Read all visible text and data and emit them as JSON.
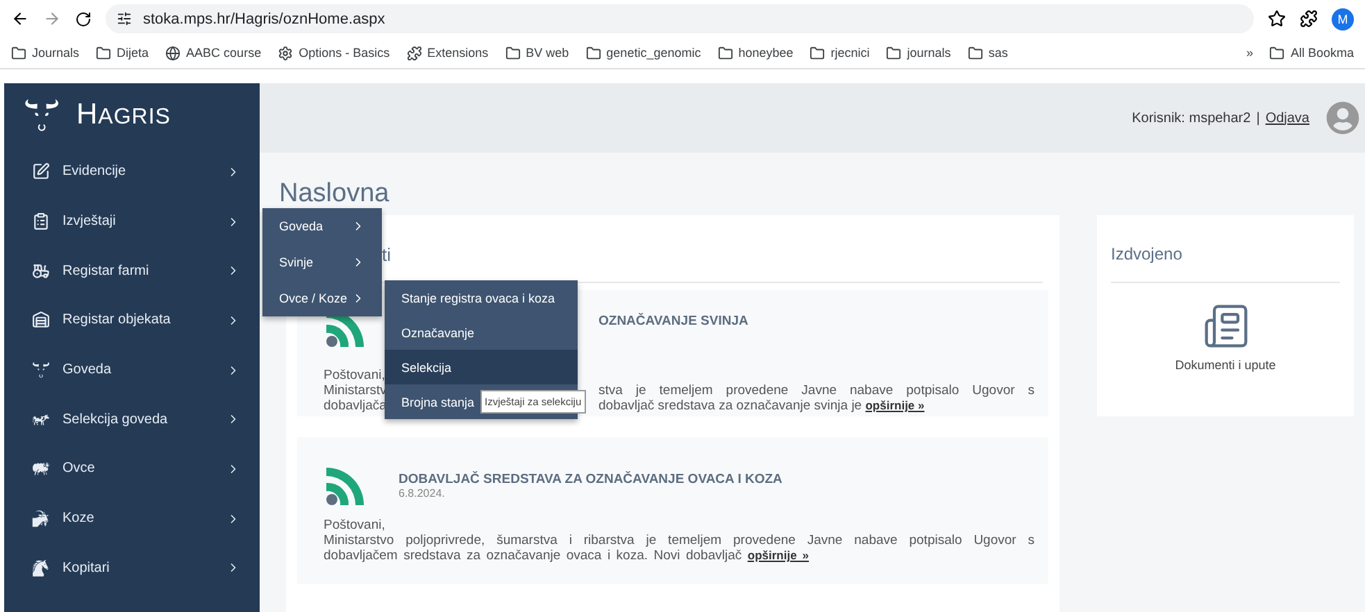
{
  "browser": {
    "url": "stoka.mps.hr/Hagris/oznHome.aspx",
    "profile_initial": "M",
    "bookmarks": [
      {
        "label": "Journals",
        "kind": "folder"
      },
      {
        "label": "Dijeta",
        "kind": "folder"
      },
      {
        "label": "AABC course",
        "kind": "globe"
      },
      {
        "label": "Options - Basics",
        "kind": "gear"
      },
      {
        "label": "Extensions",
        "kind": "puzzle"
      },
      {
        "label": "BV web",
        "kind": "folder"
      },
      {
        "label": "genetic_genomic",
        "kind": "folder"
      },
      {
        "label": "honeybee",
        "kind": "folder"
      },
      {
        "label": "rjecnici",
        "kind": "folder"
      },
      {
        "label": "journals",
        "kind": "folder"
      },
      {
        "label": "sas",
        "kind": "folder"
      }
    ],
    "overflow": "»",
    "all_bookmarks": "All Bookma"
  },
  "logo": "HAGRIS",
  "sidebar": {
    "items": [
      {
        "label": "Evidencije"
      },
      {
        "label": "Izvještaji"
      },
      {
        "label": "Registar farmi"
      },
      {
        "label": "Registar objekata"
      },
      {
        "label": "Goveda"
      },
      {
        "label": "Selekcija goveda"
      },
      {
        "label": "Ovce"
      },
      {
        "label": "Koze"
      },
      {
        "label": "Kopitari"
      }
    ]
  },
  "header": {
    "user": "Korisnik: mspehar2",
    "separator": "|",
    "logout": "Odjava"
  },
  "page_title": "Naslovna",
  "news": {
    "title": "ti",
    "first": {
      "title": "OZNAČAVANJE SVINJA",
      "greeting": "Poštovani,",
      "left": [
        "Ministarstv",
        "dobavljača"
      ],
      "right": [
        "stva je temeljem provedene Javne nabave potpisalo Ugovor s",
        "dobavljač sredstava za označavanje svinja je"
      ],
      "link": "opširnije »"
    },
    "second": {
      "title": "DOBAVLJAČ SREDSTAVA ZA OZNAČAVANJE OVACA I KOZA",
      "date": "6.8.2024.",
      "greeting": "Poštovani,",
      "body": "Ministarstvo poljoprivrede, šumarstva i ribarstva je temeljem provedene Javne nabave potpisalo Ugovor s dobavljačem sredstava za označavanje ovaca i koza. Novi dobavljač",
      "link": "opširnije »"
    }
  },
  "featured": {
    "title": "Izdvojeno",
    "items": [
      {
        "label": "Dokumenti i upute"
      }
    ]
  },
  "flyout_menus": [
    {
      "items": [
        {
          "label": "Goveda",
          "submenu": true,
          "selected": false
        },
        {
          "label": "Svinje",
          "submenu": true,
          "selected": false
        },
        {
          "label": "Ovce / Koze",
          "submenu": true,
          "selected": false
        }
      ]
    },
    {
      "items": [
        {
          "label": "Stanje registra ovaca i koza",
          "selected": false
        },
        {
          "label": "Označavanje",
          "selected": false
        },
        {
          "label": "Selekcija",
          "selected": true
        },
        {
          "label": "Brojna stanja",
          "selected": false
        }
      ]
    }
  ],
  "tooltip": "Izvještaji za selekciju"
}
